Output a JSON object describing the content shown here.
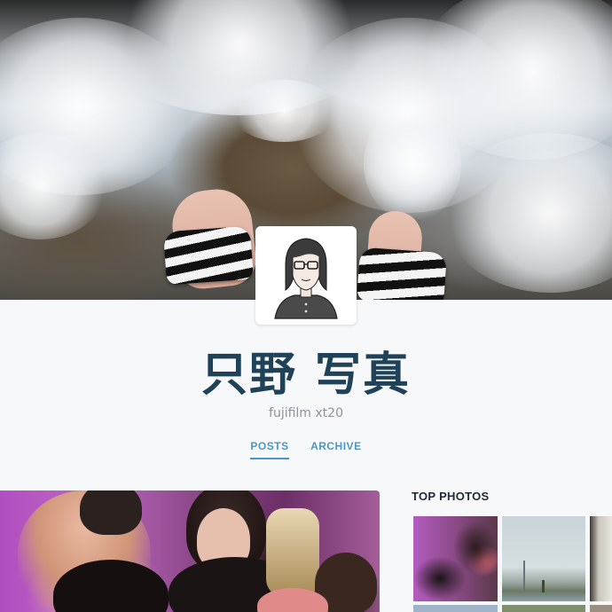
{
  "profile": {
    "name": "只野 写真",
    "description": "fujifilm xt20"
  },
  "tabs": [
    {
      "label": "POSTS",
      "active": true
    },
    {
      "label": "ARCHIVE",
      "active": false
    }
  ],
  "sidebar": {
    "title": "TOP PHOTOS"
  },
  "colors": {
    "title": "#1f4259",
    "accent": "#4e95c4",
    "background": "#f7f8f9"
  }
}
